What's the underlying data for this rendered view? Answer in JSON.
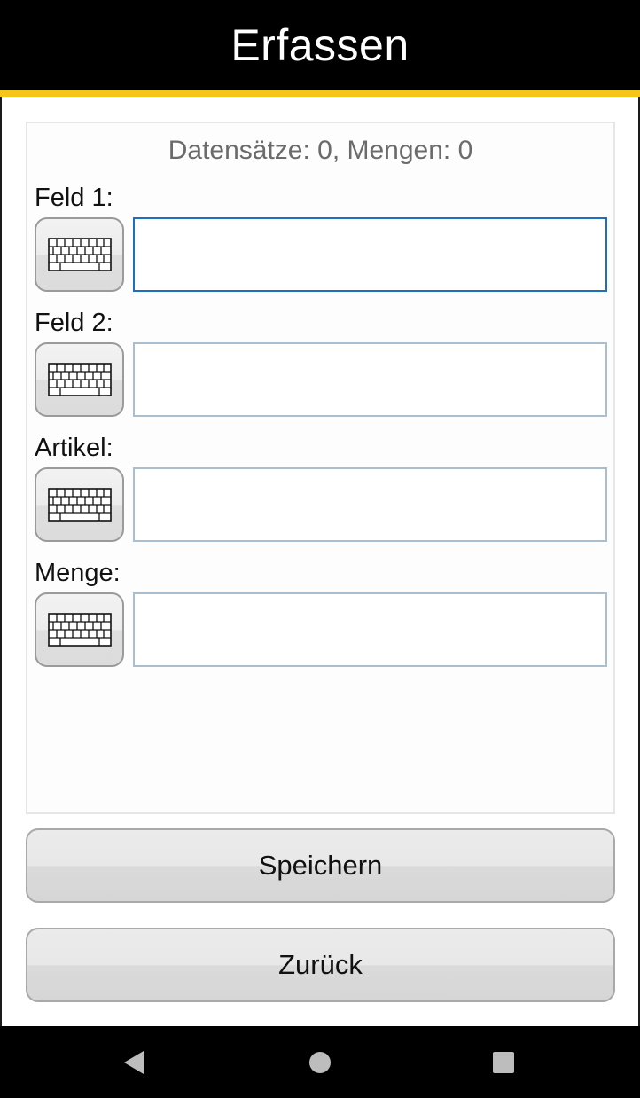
{
  "header": {
    "title": "Erfassen",
    "accent_color": "#f5c518",
    "background": "#000000"
  },
  "status": {
    "text": "Datensätze: 0, Mengen: 0"
  },
  "fields": [
    {
      "label": "Feld 1:",
      "value": "",
      "placeholder": "",
      "focused": true,
      "button_icon": "keyboard-icon"
    },
    {
      "label": "Feld 2:",
      "value": "",
      "placeholder": "",
      "focused": false,
      "button_icon": "keyboard-icon"
    },
    {
      "label": "Artikel:",
      "value": "",
      "placeholder": "",
      "focused": false,
      "button_icon": "keyboard-icon"
    },
    {
      "label": "Menge:",
      "value": "",
      "placeholder": "",
      "focused": false,
      "button_icon": "keyboard-icon"
    }
  ],
  "actions": {
    "save_label": "Speichern",
    "back_label": "Zurück"
  },
  "navbar": {
    "icons": [
      "back-triangle-icon",
      "home-circle-icon",
      "recents-square-icon"
    ]
  },
  "colors": {
    "focus_border": "#1f6fbf",
    "input_border": "#a9bfcf"
  }
}
